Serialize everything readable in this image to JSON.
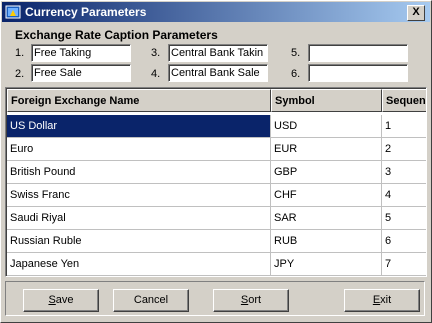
{
  "window": {
    "title": "Currency Parameters",
    "close_label": "X"
  },
  "caption_params": {
    "heading": "Exchange Rate Caption Parameters",
    "fields": [
      {
        "num": "1.",
        "value": "Free Taking"
      },
      {
        "num": "2.",
        "value": "Free Sale"
      },
      {
        "num": "3.",
        "value": "Central Bank Takin"
      },
      {
        "num": "4.",
        "value": "Central Bank Sale"
      },
      {
        "num": "5.",
        "value": ""
      },
      {
        "num": "6.",
        "value": ""
      }
    ]
  },
  "grid": {
    "columns": [
      "Foreign Exchange Name",
      "Symbol",
      "Sequen"
    ],
    "rows": [
      {
        "name": "US Dollar",
        "symbol": "USD",
        "seq": "1"
      },
      {
        "name": "Euro",
        "symbol": "EUR",
        "seq": "2"
      },
      {
        "name": "British Pound",
        "symbol": "GBP",
        "seq": "3"
      },
      {
        "name": "Swiss Franc",
        "symbol": "CHF",
        "seq": "4"
      },
      {
        "name": "Saudi Riyal",
        "symbol": "SAR",
        "seq": "5"
      },
      {
        "name": "Russian Ruble",
        "symbol": "RUB",
        "seq": "6"
      },
      {
        "name": "Japanese Yen",
        "symbol": "JPY",
        "seq": "7"
      }
    ],
    "selected_row": 0
  },
  "buttons": {
    "save": {
      "label": "Save",
      "hotkey": "S"
    },
    "cancel": {
      "label": "Cancel"
    },
    "sort": {
      "label": "Sort",
      "hotkey": "S"
    },
    "exit": {
      "label": "Exit",
      "hotkey": "E"
    }
  },
  "colors": {
    "titlebar_start": "#0a246a",
    "titlebar_end": "#a6caf0",
    "selection": "#0a246a",
    "face": "#d4d0c8"
  }
}
